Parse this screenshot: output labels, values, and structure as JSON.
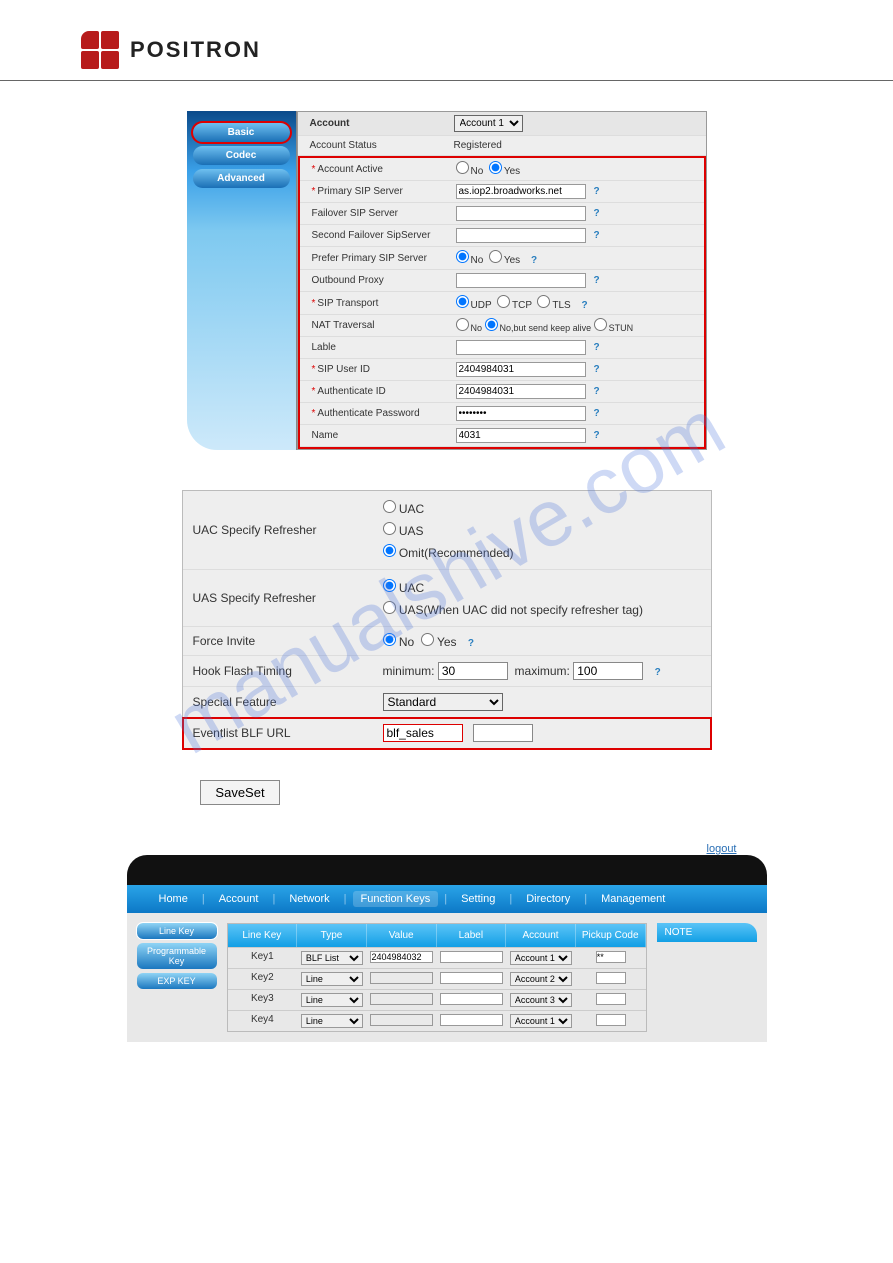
{
  "header": {
    "brand": "POSITRON"
  },
  "watermark": "manualshive.com",
  "shot1": {
    "tabs": [
      "Basic",
      "Codec",
      "Advanced"
    ],
    "title": "Account",
    "account_select": "Account 1",
    "rows": {
      "status_lbl": "Account Status",
      "status_val": "Registered",
      "active_lbl": "Account Active",
      "active_no": "No",
      "active_yes": "Yes",
      "primary_lbl": "Primary SIP Server",
      "primary_val": "as.iop2.broadworks.net",
      "failover_lbl": "Failover SIP Server",
      "second_failover_lbl": "Second Failover SipServer",
      "prefer_lbl": "Prefer Primary SIP Server",
      "prefer_no": "No",
      "prefer_yes": "Yes",
      "outbound_lbl": "Outbound Proxy",
      "transport_lbl": "SIP Transport",
      "udp": "UDP",
      "tcp": "TCP",
      "tls": "TLS",
      "nat_lbl": "NAT Traversal",
      "nat_no": "No",
      "nat_keep": "No,but send keep alive",
      "nat_stun": "STUN",
      "lable_lbl": "Lable",
      "sipuser_lbl": "SIP User ID",
      "sipuser_val": "2404984031",
      "authid_lbl": "Authenticate ID",
      "authid_val": "2404984031",
      "authpw_lbl": "Authenticate Password",
      "authpw_val": "••••••••",
      "name_lbl": "Name",
      "name_val": "4031"
    }
  },
  "shot2": {
    "uac_lbl": "UAC Specify Refresher",
    "uac_opt1": "UAC",
    "uac_opt2": "UAS",
    "uac_opt3": "Omit(Recommended)",
    "uas_lbl": "UAS Specify Refresher",
    "uas_opt1": "UAC",
    "uas_opt2": "UAS(When UAC did not specify refresher tag)",
    "force_lbl": "Force Invite",
    "force_no": "No",
    "force_yes": "Yes",
    "hook_lbl": "Hook Flash Timing",
    "hook_min_lbl": "minimum:",
    "hook_min": "30",
    "hook_max_lbl": "maximum:",
    "hook_max": "100",
    "special_lbl": "Special Feature",
    "special_val": "Standard",
    "blf_lbl": "Eventlist BLF URL",
    "blf_val": "blf_sales"
  },
  "saveset": "SaveSet",
  "shot3": {
    "logout": "logout",
    "nav": [
      "Home",
      "Account",
      "Network",
      "Function Keys",
      "Setting",
      "Directory",
      "Management"
    ],
    "side": [
      "Line Key",
      "Programmable Key",
      "EXP KEY"
    ],
    "cols": [
      "Line Key",
      "Type",
      "Value",
      "Label",
      "Account",
      "Pickup Code"
    ],
    "rows": [
      {
        "k": "Key1",
        "type": "BLF List",
        "value": "2404984032",
        "label": "",
        "acct": "Account 1",
        "pickup": "**"
      },
      {
        "k": "Key2",
        "type": "Line",
        "value": "",
        "label": "",
        "acct": "Account 2",
        "pickup": ""
      },
      {
        "k": "Key3",
        "type": "Line",
        "value": "",
        "label": "",
        "acct": "Account 3",
        "pickup": ""
      },
      {
        "k": "Key4",
        "type": "Line",
        "value": "",
        "label": "",
        "acct": "Account 1",
        "pickup": ""
      }
    ],
    "note": "NOTE"
  }
}
